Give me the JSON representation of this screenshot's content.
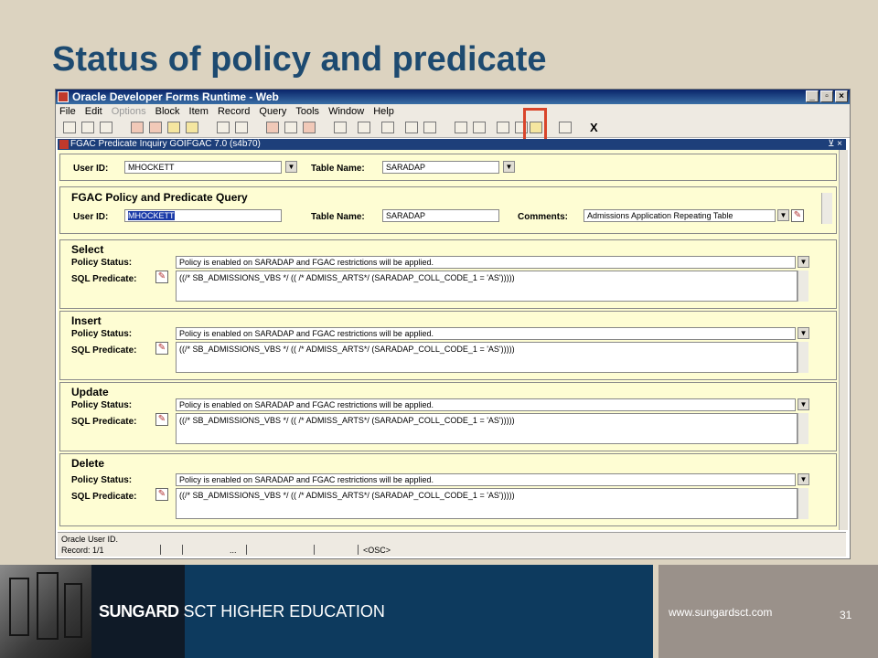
{
  "slide": {
    "title": "Status of policy and predicate",
    "url": "www.sungardsct.com",
    "page_number": "31",
    "brand_bold": "SUNGARD",
    "brand_rest": " SCT HIGHER EDUCATION"
  },
  "window": {
    "title": "Oracle Developer Forms Runtime - Web",
    "controls": [
      "_",
      "▫",
      "×"
    ],
    "menu": [
      {
        "label": "File",
        "disabled": false
      },
      {
        "label": "Edit",
        "disabled": false
      },
      {
        "label": "Options",
        "disabled": true
      },
      {
        "label": "Block",
        "disabled": false
      },
      {
        "label": "Item",
        "disabled": false
      },
      {
        "label": "Record",
        "disabled": false
      },
      {
        "label": "Query",
        "disabled": false
      },
      {
        "label": "Tools",
        "disabled": false
      },
      {
        "label": "Window",
        "disabled": false
      },
      {
        "label": "Help",
        "disabled": false
      }
    ],
    "toolbar_exit": "X",
    "form_title": "FGAC Predicate Inquiry  GOIFGAC  7.0  (s4b70)",
    "form_controls": "⊻ ×"
  },
  "key_block": {
    "user_id_label": "User ID:",
    "user_id": "MHOCKETT",
    "table_name_label": "Table Name:",
    "table_name": "SARADAP"
  },
  "query_block": {
    "heading": "FGAC Policy and Predicate Query",
    "user_id_label": "User ID:",
    "user_id": "MHOCKETT",
    "table_name_label": "Table Name:",
    "table_name": "SARADAP",
    "comments_label": "Comments:",
    "comments": "Admissions Application Repeating Table"
  },
  "sections": [
    {
      "heading": "Select",
      "policy_label": "Policy Status:",
      "policy_status": "Policy is enabled on SARADAP and FGAC restrictions will be applied.",
      "sql_label": "SQL Predicate:",
      "sql_predicate": "((/* SB_ADMISSIONS_VBS */ (( /* ADMISS_ARTS*/ (SARADAP_COLL_CODE_1 = 'AS')))))"
    },
    {
      "heading": "Insert",
      "policy_label": "Policy Status:",
      "policy_status": "Policy is enabled on SARADAP and FGAC restrictions will be applied.",
      "sql_label": "SQL Predicate:",
      "sql_predicate": "((/* SB_ADMISSIONS_VBS */ (( /* ADMISS_ARTS*/ (SARADAP_COLL_CODE_1 = 'AS')))))"
    },
    {
      "heading": "Update",
      "policy_label": "Policy Status:",
      "policy_status": "Policy is enabled on SARADAP  and FGAC restrictions will be applied.",
      "sql_label": "SQL Predicate:",
      "sql_predicate": "((/* SB_ADMISSIONS_VBS */ (( /* ADMISS_ARTS*/ (SARADAP_COLL_CODE_1 = 'AS')))))"
    },
    {
      "heading": "Delete",
      "policy_label": "Policy Status:",
      "policy_status": "Policy is enabled on SARADAP and FGAC restrictions will be applied.",
      "sql_label": "SQL Predicate:",
      "sql_predicate": "((/* SB_ADMISSIONS_VBS */ (( /* ADMISS_ARTS*/ (SARADAP_COLL_CODE_1 = 'AS')))))"
    }
  ],
  "status_bar": {
    "hint": "Oracle User ID.",
    "record": "Record: 1/1",
    "ellipsis": "...",
    "mode": "<OSC>"
  },
  "colors": {
    "title": "#1d4a70",
    "form_background": "#fefdd3",
    "highlight_box": "#d9452b",
    "footer_navy": "#0d3a5e"
  }
}
